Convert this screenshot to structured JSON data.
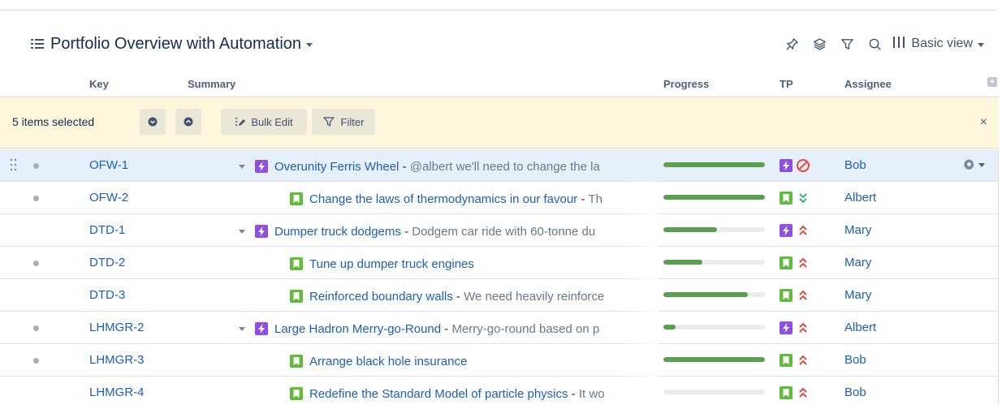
{
  "view": {
    "title": "Portfolio Overview with Automation",
    "mode_label": "Basic view"
  },
  "toolbar_icons": [
    "pin-icon",
    "layers-icon",
    "filter-icon",
    "search-icon",
    "columns-icon"
  ],
  "columns": {
    "key": "Key",
    "summary": "Summary",
    "progress": "Progress",
    "tp": "TP",
    "assignee": "Assignee"
  },
  "selection": {
    "count_text": "5 items selected",
    "bulk_edit_label": "Bulk Edit",
    "filter_label": "Filter",
    "close_glyph": "×"
  },
  "colors": {
    "link": "#1d5fb8",
    "selection_bar": "#fef7dd",
    "selected_row": "#e6f0fb",
    "progress_fill": "#5aa04e",
    "epic": "#904ee2",
    "story": "#63ba3c",
    "priority_high": "#e5493a",
    "priority_low": "#36b37e"
  },
  "rows": [
    {
      "key": "OFW-1",
      "type": "epic",
      "expandable": true,
      "selected": true,
      "bullet": true,
      "title": "Overunity Ferris Wheel",
      "desc": "@albert we'll need to change the la",
      "progress": 1.0,
      "tp_status": "blocked",
      "assignee": "Bob"
    },
    {
      "key": "OFW-2",
      "type": "story",
      "expandable": false,
      "selected": false,
      "bullet": true,
      "title": "Change the laws of thermodynamics in our favour",
      "desc": "Th",
      "progress": 1.0,
      "tp_status": "low",
      "assignee": "Albert"
    },
    {
      "key": "DTD-1",
      "type": "epic",
      "expandable": true,
      "selected": false,
      "bullet": false,
      "title": "Dumper truck dodgems",
      "desc": "Dodgem car ride with 60-tonne du",
      "progress": 0.53,
      "tp_status": "high",
      "assignee": "Mary"
    },
    {
      "key": "DTD-2",
      "type": "story",
      "expandable": false,
      "selected": false,
      "bullet": true,
      "title": "Tune up dumper truck engines",
      "desc": "",
      "progress": 0.38,
      "tp_status": "high",
      "assignee": "Mary"
    },
    {
      "key": "DTD-3",
      "type": "story",
      "expandable": false,
      "selected": false,
      "bullet": false,
      "title": "Reinforced boundary walls",
      "desc": "We need heavily reinforce",
      "progress": 0.83,
      "tp_status": "high",
      "assignee": "Mary"
    },
    {
      "key": "LHMGR-2",
      "type": "epic",
      "expandable": true,
      "selected": false,
      "bullet": true,
      "title": "Large Hadron Merry-go-Round",
      "desc": "Merry-go-round based on p",
      "progress": 0.12,
      "tp_status": "high",
      "assignee": "Albert"
    },
    {
      "key": "LHMGR-3",
      "type": "story",
      "expandable": false,
      "selected": false,
      "bullet": true,
      "title": "Arrange black hole insurance",
      "desc": "",
      "progress": 1.0,
      "tp_status": "high",
      "assignee": "Bob"
    },
    {
      "key": "LHMGR-4",
      "type": "story",
      "expandable": false,
      "selected": false,
      "bullet": false,
      "title": "Redefine the Standard Model of particle physics",
      "desc": "It wo",
      "progress": 0.0,
      "tp_status": "high",
      "assignee": "Bob"
    }
  ]
}
